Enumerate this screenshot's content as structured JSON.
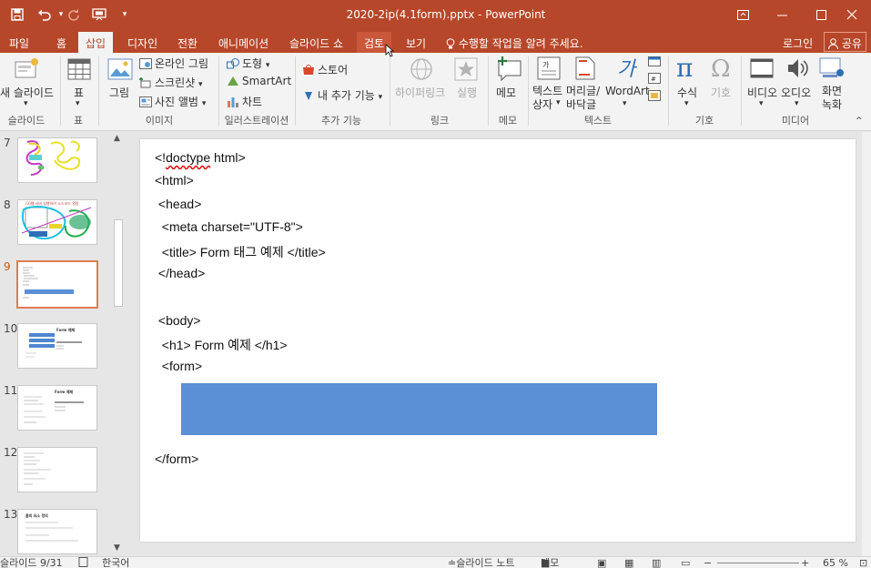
{
  "title_bar": {
    "document_title": "2020-2ip(4.1form).pptx - PowerPoint",
    "quick_access": [
      "save-icon",
      "undo-icon",
      "redo-icon",
      "present-icon",
      "customize-icon"
    ],
    "window_controls": [
      "ribbon-display-icon",
      "minimize-icon",
      "maximize-icon",
      "close-icon"
    ]
  },
  "tabs": [
    {
      "label": "파일"
    },
    {
      "label": "홈"
    },
    {
      "label": "삽입",
      "active": true
    },
    {
      "label": "디자인"
    },
    {
      "label": "전환"
    },
    {
      "label": "애니메이션"
    },
    {
      "label": "슬라이드 쇼"
    },
    {
      "label": "검토",
      "hover": true
    },
    {
      "label": "보기"
    }
  ],
  "tell_me": "수행할 작업을 알려 주세요.",
  "login": "로그인",
  "share": "공유",
  "ribbon": {
    "new_slide": "새 슬라이드",
    "table": "표",
    "picture": "그림",
    "online_picture": "온라인 그림",
    "screenshot": "스크린샷",
    "photo_album": "사진 앨범",
    "shapes": "도형",
    "smartart": "SmartArt",
    "chart": "차트",
    "store": "스토어",
    "my_addins": "내 추가 기능",
    "hyperlink": "하이퍼링크",
    "action": "실행",
    "comment": "메모",
    "textbox": "텍스트\n상자",
    "header_footer": "머리글/\n바닥글",
    "wordart": "WordArt",
    "equation": "수식",
    "symbol": "기호",
    "video": "비디오",
    "audio": "오디오",
    "screen_recording": "화면\n녹화",
    "groups": {
      "slides": "슬라이드",
      "tables": "표",
      "images": "이미지",
      "illustrations": "일러스트레이션",
      "addins": "추가 기능",
      "links": "링크",
      "comments": "메모",
      "text": "텍스트",
      "symbols": "기호",
      "media": "미디어"
    }
  },
  "thumbnails": [
    {
      "number": "7"
    },
    {
      "number": "8",
      "caption": "(3)웹 서버 실행하여 소스코드 열람 "
    },
    {
      "number": "9",
      "active": true
    },
    {
      "number": "10",
      "caption": "Form 예제"
    },
    {
      "number": "11",
      "caption": "Form 예제"
    },
    {
      "number": "12"
    },
    {
      "number": "13",
      "caption": "폼의 요소 정의"
    }
  ],
  "slide": {
    "lines": [
      {
        "prefix": "<!",
        "spell": "doctype",
        "suffix": " html>"
      },
      {
        "text": "<html>"
      },
      {
        "text": " <head>"
      },
      {
        "text": "  <meta charset=\"UTF-8\">"
      },
      {
        "text": "  <title> Form 태그 예제 </title>"
      },
      {
        "text": " </head>"
      },
      {
        "text": " <body>"
      },
      {
        "text": "  <h1> Form 예제 </h1>"
      },
      {
        "text": "  <form>"
      },
      {
        "text": "</form>"
      }
    ],
    "box_color": "#5b8fd6"
  },
  "status": {
    "slide_info": "슬라이드 9/31",
    "language": "한국어",
    "notes": "슬라이드 노트",
    "comments": "메모",
    "zoom": "65 %"
  },
  "colors": {
    "accent": "#b7472a",
    "ribbon_bg": "#f3f3f3",
    "active_thumb_border": "#e07b53"
  }
}
